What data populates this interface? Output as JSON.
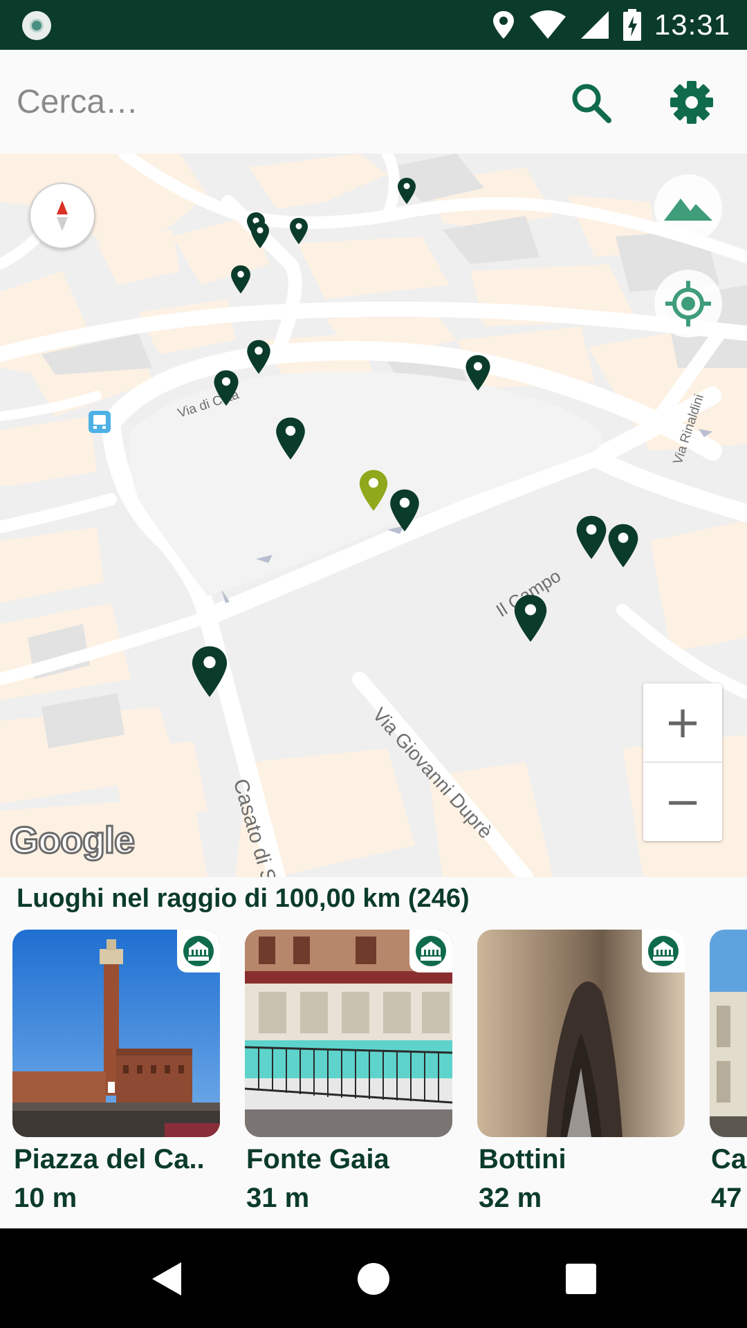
{
  "status_bar": {
    "time": "13:31",
    "icons": [
      "app-notification-icon",
      "location-icon",
      "wifi-icon",
      "signal-icon",
      "battery-charging-icon"
    ]
  },
  "search": {
    "placeholder": "Cerca…",
    "value": ""
  },
  "toolbar": {
    "search_icon": "search-icon",
    "settings_icon": "gear-icon"
  },
  "map": {
    "streets": {
      "via_di_citta": "Via di Città",
      "via_rinaldini": "Via Rinaldini",
      "il_campo": "Il Campo",
      "via_giovanni_dupre": "Via Giovanni Duprè",
      "casato_di_sotto": "Casato di Sotto"
    },
    "attribution": "Google",
    "controls": {
      "zoom_in": "+",
      "zoom_out": "−",
      "terrain_icon": "terrain-icon",
      "my_location_icon": "my-location-icon",
      "compass_icon": "compass-icon"
    },
    "colors": {
      "pin": "#0b3b2b",
      "selected_pin": "#8fa81c",
      "building": "#fdf1e3",
      "block": "#e8e8e8",
      "road": "#ffffff"
    }
  },
  "places": {
    "title": "Luoghi nel raggio di 100,00 km (246)",
    "items": [
      {
        "name": "Piazza del Ca..",
        "distance": "10 m"
      },
      {
        "name": "Fonte Gaia",
        "distance": "31 m"
      },
      {
        "name": "Bottini",
        "distance": "32 m"
      },
      {
        "name": "Cap",
        "distance": "47"
      }
    ],
    "badge_icon": "nice-places-logo-icon"
  },
  "nav": {
    "back_icon": "back-icon",
    "home_icon": "home-icon",
    "recents_icon": "recents-icon"
  }
}
